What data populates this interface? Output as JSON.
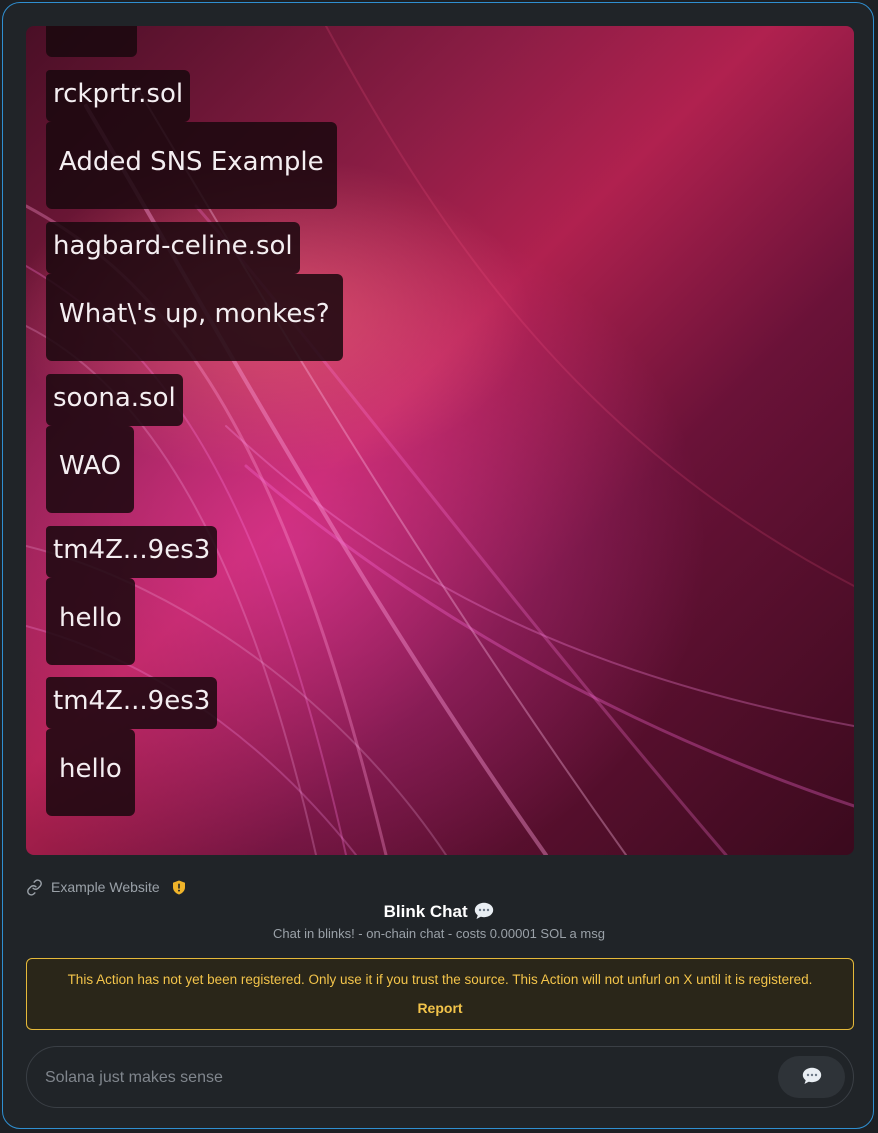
{
  "messages": [
    {
      "name": "",
      "text": ""
    },
    {
      "name": "rckprtr.sol",
      "text": "Added SNS Example"
    },
    {
      "name": "hagbard-celine.sol",
      "text": "What\\'s up, monkes?"
    },
    {
      "name": "soona.sol",
      "text": "WAO"
    },
    {
      "name": "tm4Z...9es3",
      "text": "hello"
    },
    {
      "name": "tm4Z...9es3",
      "text": "hello"
    }
  ],
  "source": {
    "label": "Example Website",
    "link_icon": "link-icon",
    "badge_icon": "warning-shield-icon"
  },
  "action": {
    "title": "Blink Chat",
    "title_icon": "speech-bubble-icon",
    "description": "Chat in blinks! - on-chain chat - costs 0.00001 SOL a msg"
  },
  "warning": {
    "text": "This Action has not yet been registered. Only use it if you trust the source. This Action will not unfurl on X until it is registered.",
    "report_label": "Report",
    "color": "#f3c44a"
  },
  "input": {
    "placeholder": "Solana just makes sense",
    "value": ""
  },
  "send_button": {
    "icon": "speech-bubble-icon"
  },
  "colors": {
    "card_border": "#2f8fd1",
    "card_bg": "#202428"
  }
}
